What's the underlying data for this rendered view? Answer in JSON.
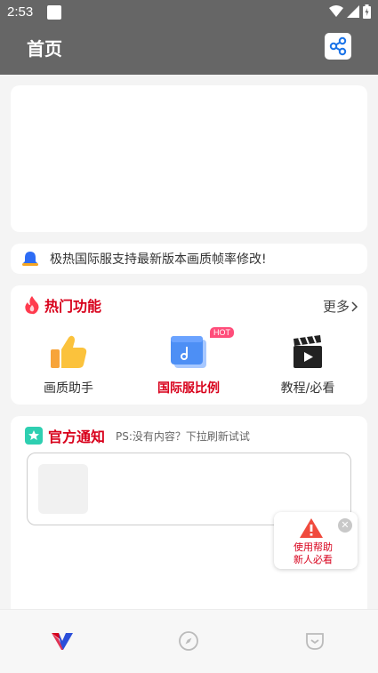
{
  "status_bar": {
    "time": "2:53"
  },
  "app_bar": {
    "title": "首页",
    "share_icon": "share-icon"
  },
  "notice": {
    "text": "极热国际服支持最新版本画质帧率修改!",
    "icon": "bell-icon"
  },
  "hot_features": {
    "title": "热门功能",
    "more_label": "更多",
    "items": [
      {
        "label": "画质助手",
        "icon": "thumbs-up-icon"
      },
      {
        "label": "国际服比例",
        "icon": "ratio-window-icon",
        "badge": "HOT"
      },
      {
        "label": "教程/必看",
        "icon": "clapperboard-icon"
      }
    ]
  },
  "official": {
    "title": "官方通知",
    "hint": "PS:没有内容？下拉刷新试试"
  },
  "help_float": {
    "line1": "使用帮助",
    "line2": "新人必看"
  },
  "tabs": [
    {
      "name": "home",
      "icon": "v-logo-icon"
    },
    {
      "name": "discover",
      "icon": "compass-icon"
    },
    {
      "name": "profile",
      "icon": "pocket-icon"
    }
  ],
  "colors": {
    "accent": "#d8001b",
    "header": "#666666",
    "hot_badge": "#ff4d7a"
  }
}
